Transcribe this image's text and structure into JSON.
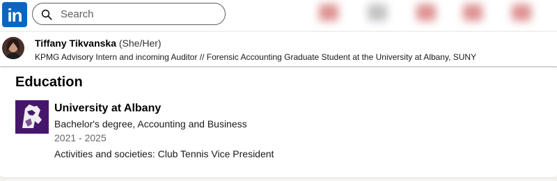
{
  "nav": {
    "logo_text": "in",
    "search": {
      "placeholder": "Search",
      "value": ""
    },
    "colors": {
      "brand": "#0a66c2"
    }
  },
  "profile": {
    "name": "Tiffany Tikvanska",
    "pronouns": "(She/Her)",
    "headline": "KPMG Advisory Intern and incoming Auditor // Forensic Accounting Graduate Student at the University at Albany, SUNY"
  },
  "education": {
    "title": "Education",
    "entries": [
      {
        "school": "University at Albany",
        "degree": "Bachelor's degree, Accounting and Business",
        "dates": "2021 - 2025",
        "activities": "Activities and societies: Club Tennis Vice President",
        "logo_icon": "great-dane-icon",
        "logo_color": "#46166b"
      }
    ]
  }
}
